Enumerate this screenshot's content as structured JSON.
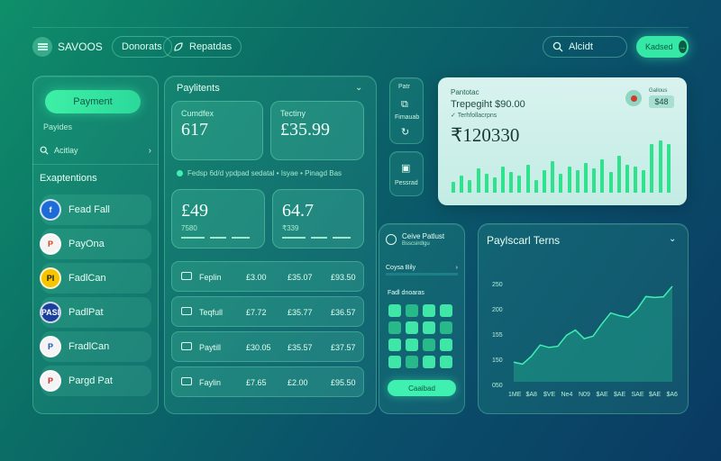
{
  "topbar": {
    "app_title": "SAVOOS",
    "pill1": "Donorats",
    "pill2": "Repatdas",
    "search_label": "Alcidt",
    "action_button": "Kadsed"
  },
  "sidebar": {
    "primary_button": "Payment",
    "caption": "Payides",
    "search_label": "Acitlay",
    "section_title": "Exaptentions",
    "items": [
      {
        "label": "Fead Fall",
        "logo": "f",
        "logo_bg": "#1c6bd6",
        "logo_color": "#ffffff"
      },
      {
        "label": "PayOna",
        "logo": "P",
        "logo_bg": "#f4f4f4",
        "logo_color": "#d4461b"
      },
      {
        "label": "FadlCan",
        "logo": "PI",
        "logo_bg": "#f6c400",
        "logo_color": "#1b1b1b"
      },
      {
        "label": "PadlPat",
        "logo": "PASI",
        "logo_bg": "#1a3f9c",
        "logo_color": "#ffffff"
      },
      {
        "label": "FradlCan",
        "logo": "P",
        "logo_bg": "#f4f4f4",
        "logo_color": "#1d4fb8"
      },
      {
        "label": "Pargd Pat",
        "logo": "P",
        "logo_bg": "#f4f4f4",
        "logo_color": "#c9272f"
      }
    ]
  },
  "payments": {
    "title": "Paylitents",
    "cards": [
      {
        "label": "Cumdfex",
        "value": "617",
        "sub": ""
      },
      {
        "label": "Tectiny",
        "value": "£35.99",
        "sub": ""
      },
      {
        "label": "",
        "value": "£49",
        "sub": "7580"
      },
      {
        "label": "",
        "value": "64.7",
        "sub": "₹339"
      }
    ],
    "note": "Fedsp 6d/d ypdpad sedatal • Isyae • Pinagd Bas",
    "rows": [
      {
        "name": "Feplin",
        "c1": "£3.00",
        "c2": "£35.07",
        "c3": "£93.50"
      },
      {
        "name": "Teqfull",
        "c1": "£7.72",
        "c2": "£35.77",
        "c3": "£36.57"
      },
      {
        "name": "Paytill",
        "c1": "£30.05",
        "c2": "£35.57",
        "c3": "£37.57"
      },
      {
        "name": "Faylin",
        "c1": "£7.65",
        "c2": "£2.00",
        "c3": "£95.50"
      }
    ]
  },
  "quick_actions": {
    "top_label": "Patr",
    "label2": "Fimauab",
    "label3": "Pessrad"
  },
  "summary": {
    "caption": "Pantotac",
    "subtitle": "Trepegiht $90.00",
    "detail": "Terhfollacrpns",
    "amount": "₹120330",
    "badge_label": "Gallous",
    "badge_value": "$48"
  },
  "keypad_panel": {
    "title": "Ceive Patlust",
    "subtitle": "Bsscsirdlgu",
    "select_label": "Coysa Bily",
    "section": "Fadl dnoaras",
    "button": "Caaibad"
  },
  "trend_chart": {
    "y_ticks": [
      "250",
      "200",
      "155",
      "150",
      "050"
    ],
    "x_ticks": [
      "1ME",
      "$A8",
      "$VE",
      "Ne4",
      "N09",
      "$AE",
      "$AE",
      "SAE",
      "$AE",
      "$A6"
    ]
  },
  "chart_data": [
    {
      "type": "bar",
      "title": "",
      "values": [
        12,
        18,
        14,
        26,
        20,
        16,
        28,
        22,
        18,
        30,
        14,
        24,
        34,
        20,
        28,
        24,
        32,
        26,
        36,
        22,
        40,
        30,
        28,
        24,
        52,
        56,
        52
      ],
      "xlabel": "",
      "ylabel": ""
    },
    {
      "type": "area",
      "title": "Paylscarl Terns",
      "x": [
        "1ME",
        "$A8",
        "$VE",
        "Ne4",
        "N09",
        "$AE",
        "$AE",
        "SAE",
        "$AE",
        "$A6"
      ],
      "values": [
        40,
        52,
        70,
        95,
        88,
        118,
        135,
        148,
        172,
        195
      ],
      "ylim": [
        0,
        250
      ],
      "xlabel": "",
      "ylabel": "",
      "colors": {
        "line": "#3ff0b0",
        "fill": "#1e9c86"
      }
    }
  ]
}
